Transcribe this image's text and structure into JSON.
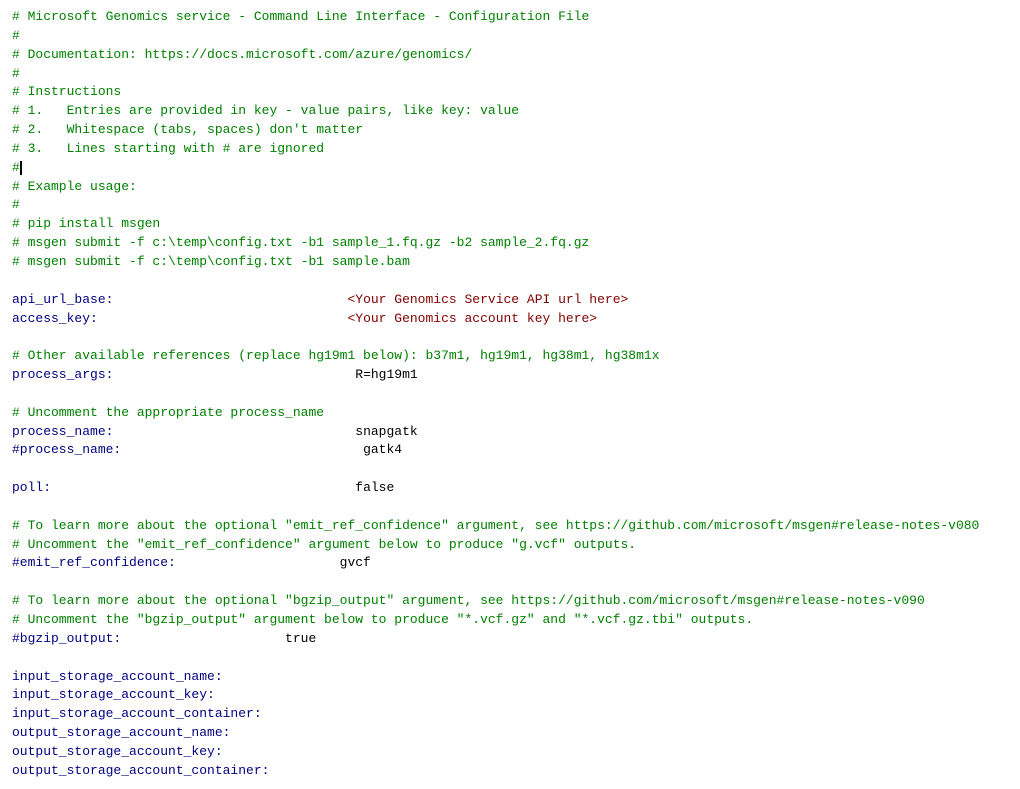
{
  "title": "Microsoft Genomics service - Command Line Interface - Configuration File",
  "lines": [
    {
      "type": "comment",
      "text": "# Microsoft Genomics service - Command Line Interface - Configuration File"
    },
    {
      "type": "comment",
      "text": "#"
    },
    {
      "type": "comment",
      "text": "# Documentation: https://docs.microsoft.com/azure/genomics/"
    },
    {
      "type": "comment",
      "text": "#"
    },
    {
      "type": "comment",
      "text": "# Instructions"
    },
    {
      "type": "comment",
      "text": "# 1.   Entries are provided in key - value pairs, like key: value"
    },
    {
      "type": "comment",
      "text": "# 2.   Whitespace (tabs, spaces) don't matter"
    },
    {
      "type": "comment",
      "text": "# 3.   Lines starting with # are ignored"
    },
    {
      "type": "cursor_comment",
      "text": "#"
    },
    {
      "type": "comment",
      "text": "# Example usage:"
    },
    {
      "type": "comment",
      "text": "#"
    },
    {
      "type": "comment",
      "text": "# pip install msgen"
    },
    {
      "type": "comment",
      "text": "# msgen submit -f c:\\temp\\config.txt -b1 sample_1.fq.gz -b2 sample_2.fq.gz"
    },
    {
      "type": "comment",
      "text": "# msgen submit -f c:\\temp\\config.txt -b1 sample.bam"
    },
    {
      "type": "blank",
      "text": ""
    },
    {
      "type": "keyval",
      "key": "api_url_base:",
      "spacing": "                              ",
      "value": "<Your Genomics Service API url here>"
    },
    {
      "type": "keyval",
      "key": "access_key:",
      "spacing": "                                ",
      "value": "<Your Genomics account key here>"
    },
    {
      "type": "blank",
      "text": ""
    },
    {
      "type": "comment",
      "text": "# Other available references (replace hg19m1 below): b37m1, hg19m1, hg38m1, hg38m1x"
    },
    {
      "type": "keyval",
      "key": "process_args:",
      "spacing": "                               ",
      "value": "R=hg19m1"
    },
    {
      "type": "blank",
      "text": ""
    },
    {
      "type": "comment",
      "text": "# Uncomment the appropriate process_name"
    },
    {
      "type": "keyval",
      "key": "process_name:",
      "spacing": "                               ",
      "value": "snapgatk"
    },
    {
      "type": "keyval",
      "key": "#process_name:",
      "spacing": "                              ",
      "value": " gatk4"
    },
    {
      "type": "blank",
      "text": ""
    },
    {
      "type": "keyval",
      "key": "poll:",
      "spacing": "                                       ",
      "value": "false"
    },
    {
      "type": "blank",
      "text": ""
    },
    {
      "type": "comment",
      "text": "# To learn more about the optional \"emit_ref_confidence\" argument, see https://github.com/microsoft/msgen#release-notes-v080"
    },
    {
      "type": "comment",
      "text": "# Uncomment the \"emit_ref_confidence\" argument below to produce \"g.vcf\" outputs."
    },
    {
      "type": "keyval",
      "key": "#emit_ref_confidence:",
      "spacing": "                     ",
      "value": "gvcf"
    },
    {
      "type": "blank",
      "text": ""
    },
    {
      "type": "comment",
      "text": "# To learn more about the optional \"bgzip_output\" argument, see https://github.com/microsoft/msgen#release-notes-v090"
    },
    {
      "type": "comment",
      "text": "# Uncomment the \"bgzip_output\" argument below to produce \"*.vcf.gz\" and \"*.vcf.gz.tbi\" outputs."
    },
    {
      "type": "keyval",
      "key": "#bgzip_output:",
      "spacing": "                     ",
      "value": "true"
    },
    {
      "type": "blank",
      "text": ""
    },
    {
      "type": "key_only",
      "text": "input_storage_account_name:"
    },
    {
      "type": "key_only",
      "text": "input_storage_account_key:"
    },
    {
      "type": "key_only",
      "text": "input_storage_account_container:"
    },
    {
      "type": "key_only",
      "text": "output_storage_account_name:"
    },
    {
      "type": "key_only",
      "text": "output_storage_account_key:"
    },
    {
      "type": "key_only",
      "text": "output_storage_account_container:"
    }
  ]
}
